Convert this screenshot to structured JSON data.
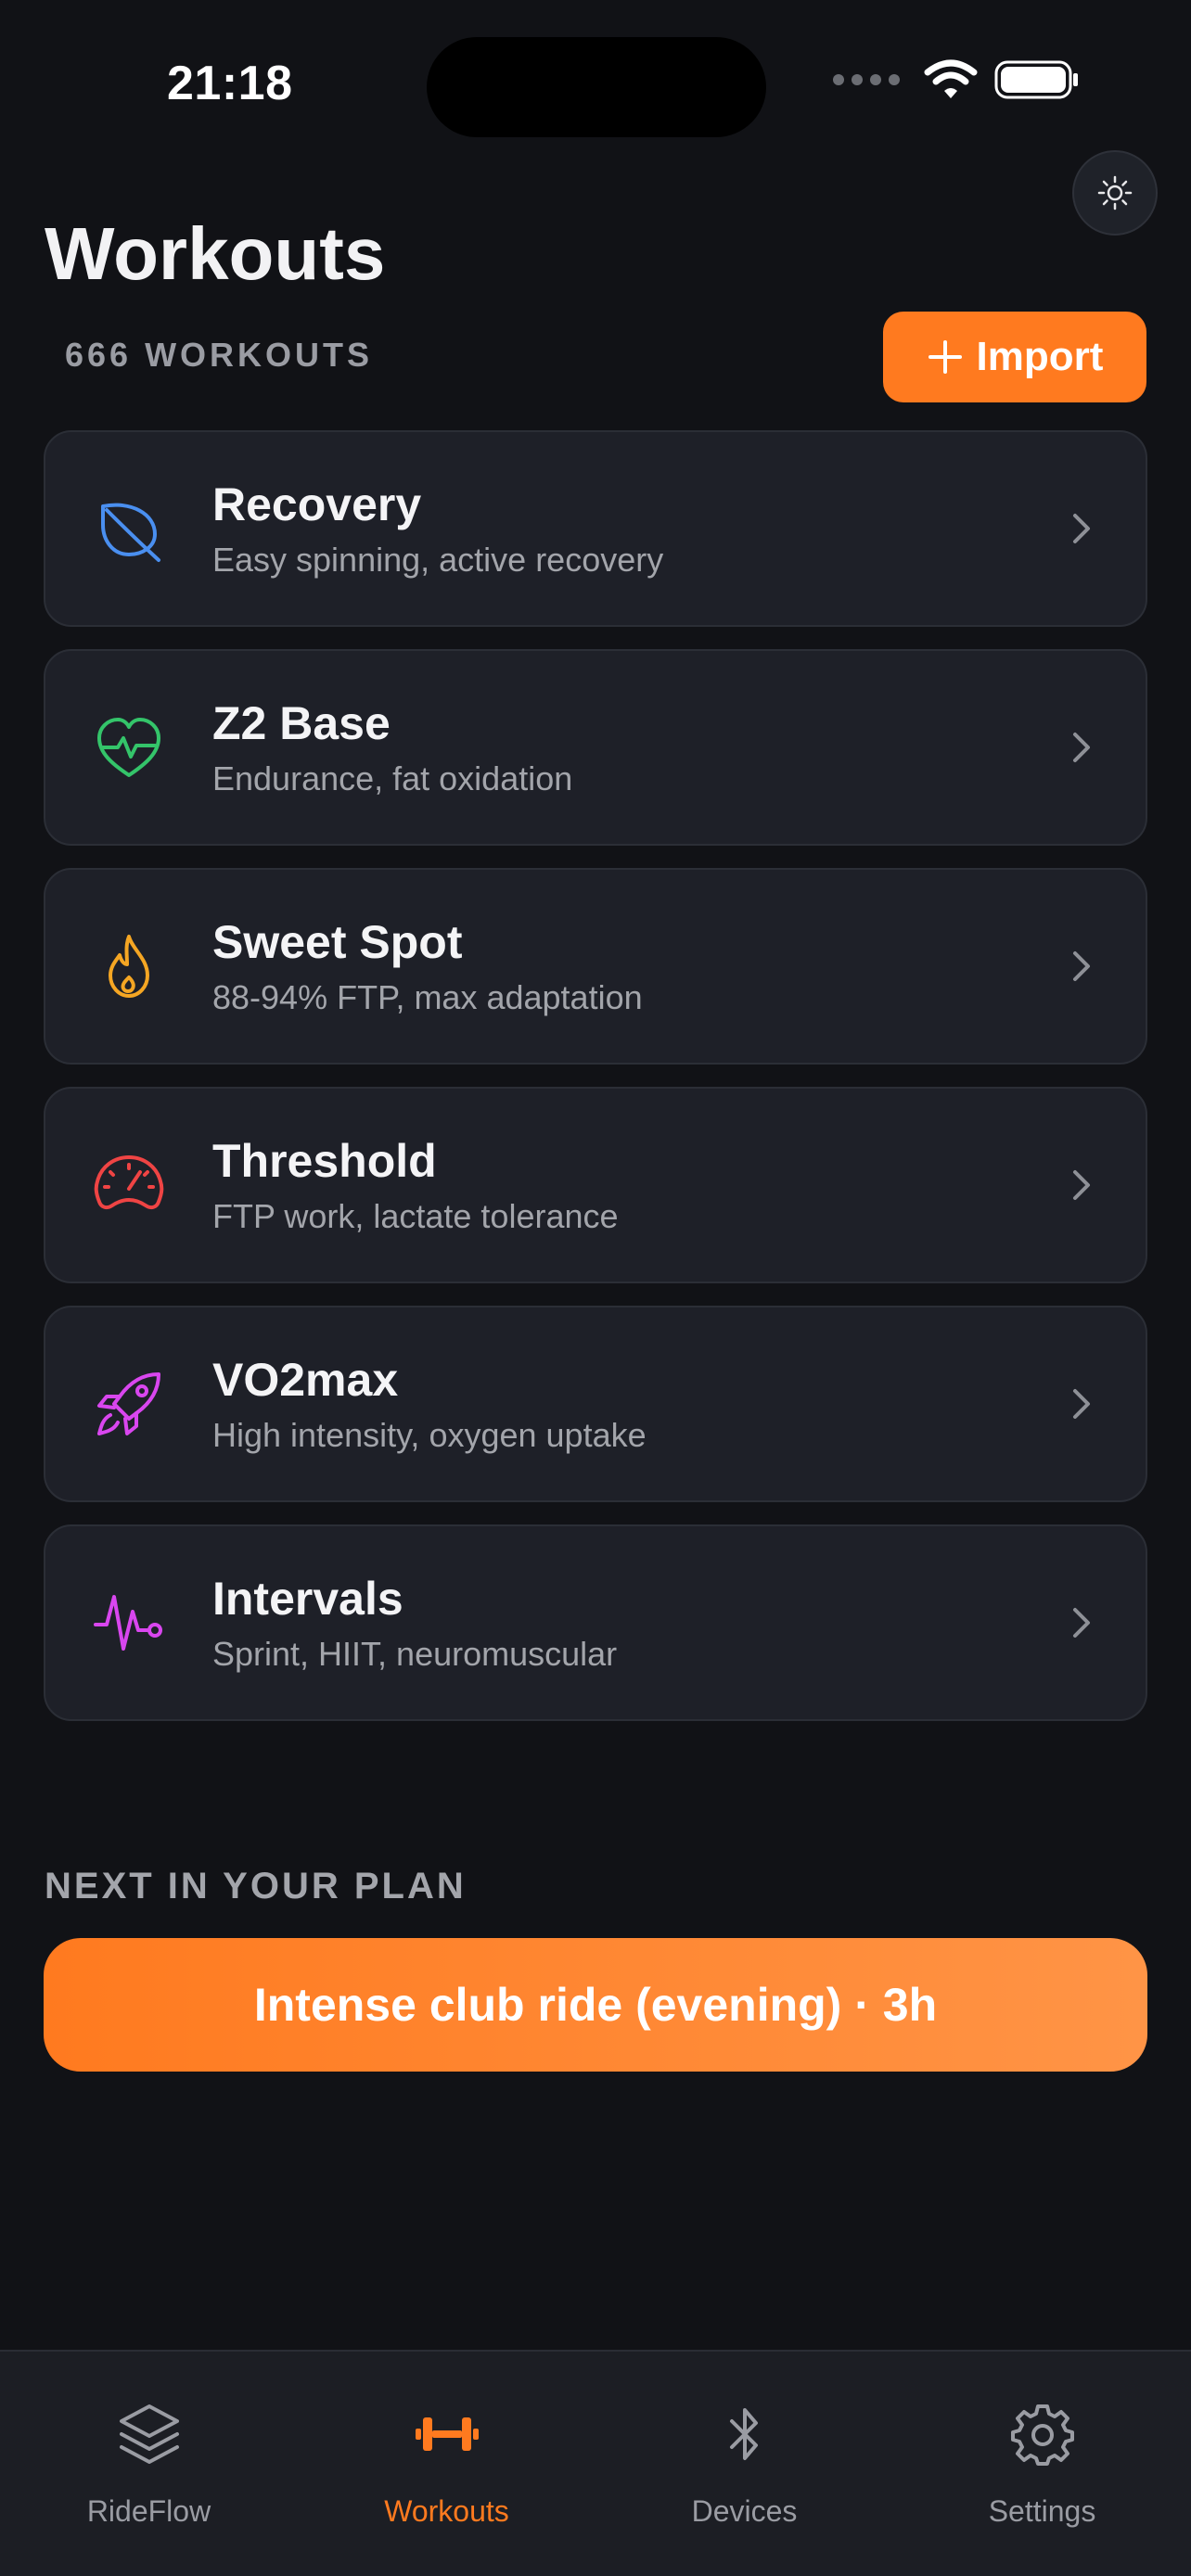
{
  "status_bar": {
    "time": "21:18"
  },
  "header": {
    "title": "Workouts",
    "count_label": "666 WORKOUTS",
    "import_label": "Import"
  },
  "categories": [
    {
      "title": "Recovery",
      "subtitle": "Easy spinning, active recovery",
      "icon": "leaf-icon",
      "color": "#4a8ff0"
    },
    {
      "title": "Z2 Base",
      "subtitle": "Endurance, fat oxidation",
      "icon": "heartbeat-icon",
      "color": "#34c46a"
    },
    {
      "title": "Sweet Spot",
      "subtitle": "88-94% FTP, max adaptation",
      "icon": "flame-icon",
      "color": "#f5a623"
    },
    {
      "title": "Threshold",
      "subtitle": "FTP work, lactate tolerance",
      "icon": "gauge-icon",
      "color": "#ef4444"
    },
    {
      "title": "VO2max",
      "subtitle": "High intensity, oxygen uptake",
      "icon": "rocket-icon",
      "color": "#d946ef"
    },
    {
      "title": "Intervals",
      "subtitle": "Sprint, HIIT, neuromuscular",
      "icon": "pulse-icon",
      "color": "#d946ef"
    }
  ],
  "plan": {
    "section_label": "NEXT IN YOUR PLAN",
    "next_label": "Intense club ride (evening) · 3h"
  },
  "tabs": [
    {
      "label": "RideFlow",
      "icon": "layers-icon",
      "active": false
    },
    {
      "label": "Workouts",
      "icon": "dumbbell-icon",
      "active": true
    },
    {
      "label": "Devices",
      "icon": "bluetooth-icon",
      "active": false
    },
    {
      "label": "Settings",
      "icon": "gear-icon",
      "active": false
    }
  ],
  "colors": {
    "accent": "#ff7a1f",
    "background": "#111216",
    "card": "#1e2028"
  }
}
